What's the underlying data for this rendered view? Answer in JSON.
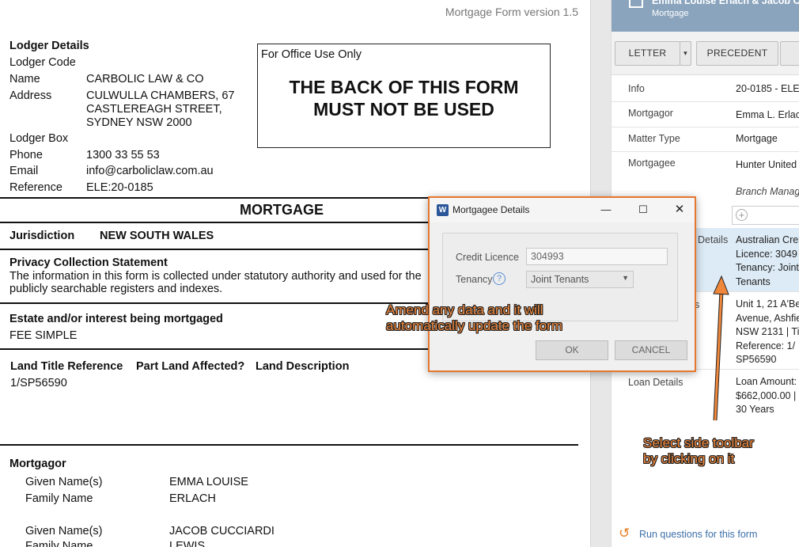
{
  "form_version": "Mortgage Form version 1.5",
  "lodger": {
    "heading": "Lodger Details",
    "code_label": "Lodger Code",
    "name_label": "Name",
    "name_value": "CARBOLIC LAW & CO",
    "address_label": "Address",
    "address_lines": [
      "CULWULLA CHAMBERS, 67",
      "CASTLEREAGH STREET,",
      "SYDNEY NSW 2000"
    ],
    "box_label": "Lodger Box",
    "phone_label": "Phone",
    "phone_value": "1300 33 55 53",
    "email_label": "Email",
    "email_value": "info@carboliclaw.com.au",
    "reference_label": "Reference",
    "reference_value": "ELE:20-0185"
  },
  "office": {
    "label": "For Office Use Only",
    "warning": "THE BACK OF THIS FORM\nMUST NOT BE USED"
  },
  "mortgage_heading": "MORTGAGE",
  "jurisdiction": {
    "label": "Jurisdiction",
    "value": "NEW SOUTH WALES"
  },
  "privacy": {
    "heading": "Privacy Collection Statement",
    "line1": "The information in this form is collected under statutory authority and used for the",
    "line2": "publicly searchable registers and indexes."
  },
  "estate": {
    "heading": "Estate and/or interest being mortgaged",
    "value": "FEE SIMPLE"
  },
  "land": {
    "col1": "Land Title Reference",
    "col2": "Part Land Affected?",
    "col3": "Land Description",
    "ref_value": "1/SP56590"
  },
  "mortgagor": {
    "heading": "Mortgagor",
    "persons": [
      {
        "given_label": "Given Name(s)",
        "given": "EMMA LOUISE",
        "family_label": "Family Name",
        "family": "ERLACH"
      },
      {
        "given_label": "Given Name(s)",
        "given": "JACOB CUCCIARDI",
        "family_label": "Family Name",
        "family": "LEWIS"
      }
    ]
  },
  "panel": {
    "title": "Emma Louise Erlach & Jacob C",
    "subtitle": "Mortgage",
    "toolbar": {
      "letter": "LETTER",
      "letter_dropdown": "▾",
      "precedent": "PRECEDENT"
    },
    "rows": {
      "info_label": "Info",
      "info_value": "20-0185 - ELE",
      "mortgagor_label": "Mortgagor",
      "mortgagor_value": "Emma L. Erlach",
      "matter_type_label": "Matter Type",
      "matter_type_value": "Mortgage",
      "mortgagee_label": "Mortgagee",
      "mortgagee_value": "Hunter United",
      "branch_value": "Branch Manag",
      "details_label_partial": "Details",
      "details_value": "Australian Cre\nLicence: 3049\nTenancy: Joint\nTenants",
      "property_label_partial": "s",
      "property_value": "Unit 1, 21 A'Be\nAvenue, Ashfie\nNSW 2131 | Ti\nReference: 1/\nSP56590",
      "loan_label": "Loan Details",
      "loan_value": "Loan Amount:\n$662,000.00 |\n30 Years"
    },
    "add_icon": "plus-circle-icon",
    "run_link": "Run questions for this form"
  },
  "dialog": {
    "title": "Mortgagee Details",
    "app_icon": "W",
    "minimize": "—",
    "maximize": "☐",
    "close": "✕",
    "credit_label": "Credit Licence",
    "credit_value": "304993",
    "tenancy_label": "Tenancy",
    "help": "?",
    "tenancy_value": "Joint Tenants",
    "ok": "OK",
    "cancel": "CANCEL"
  },
  "annotations": {
    "amend": "Amend any data and it will\nautomatically update the form",
    "toolbar": "Select side toolbar\nby clicking on it",
    "color": "#f0883c"
  }
}
